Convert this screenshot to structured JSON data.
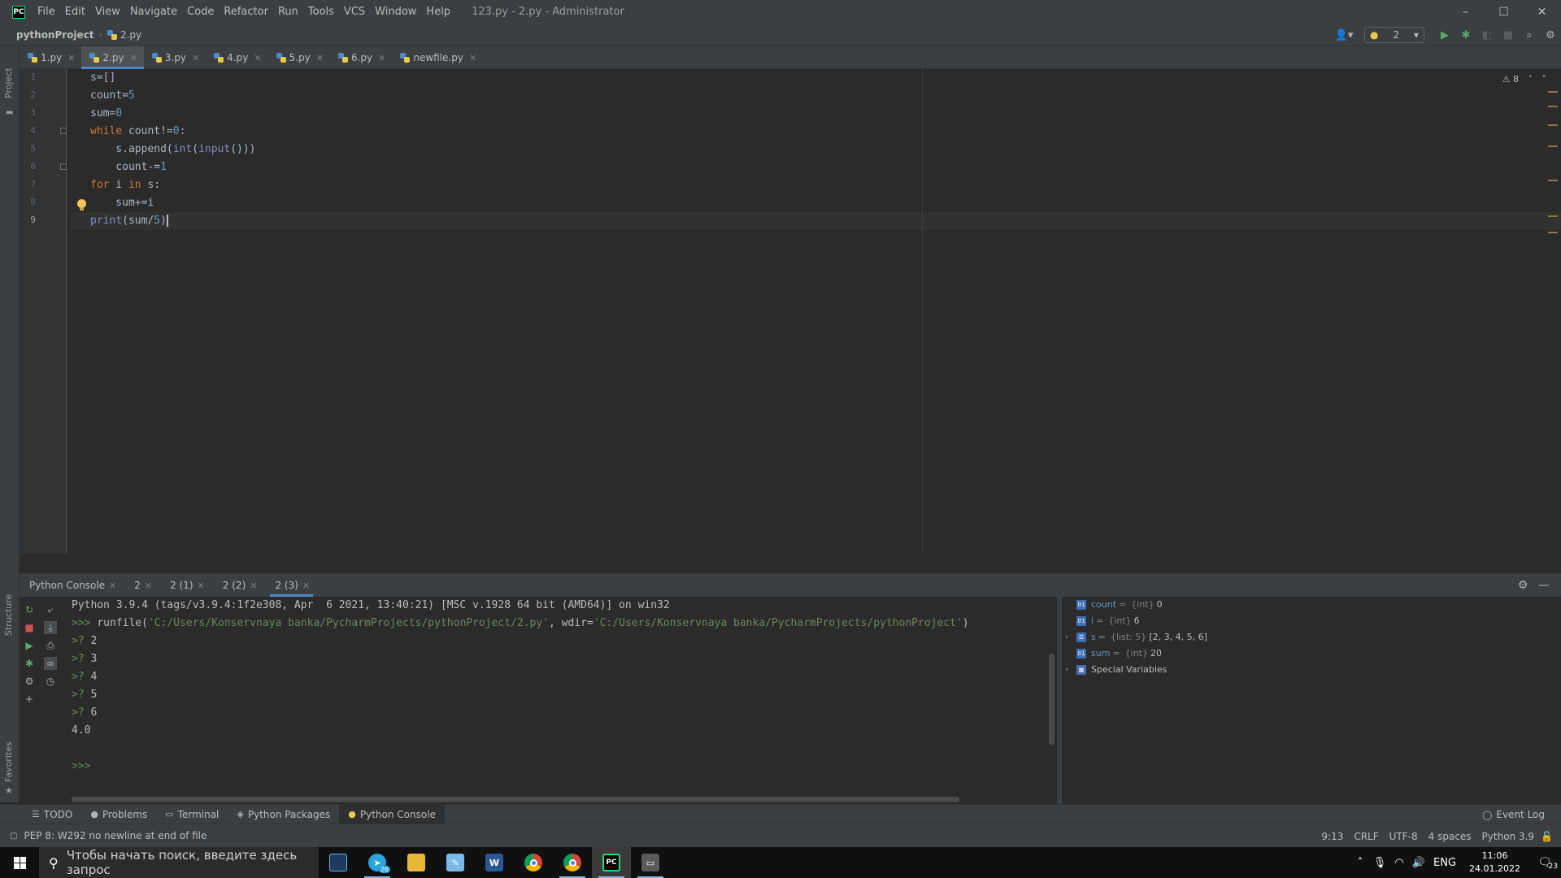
{
  "titlebar": {
    "logo": "PC",
    "menu": [
      "File",
      "Edit",
      "View",
      "Navigate",
      "Code",
      "Refactor",
      "Run",
      "Tools",
      "VCS",
      "Window",
      "Help"
    ],
    "window_title": "123.py - 2.py - Administrator",
    "controls": {
      "minimize": "–",
      "maximize": "☐",
      "close": "✕"
    }
  },
  "navbar": {
    "project": "pythonProject",
    "file": "2.py",
    "run_config": "2"
  },
  "left_stripe": {
    "project": "Project",
    "structure": "Structure",
    "favorites": "Favorites"
  },
  "editor_tabs": [
    {
      "label": "1.py",
      "active": false
    },
    {
      "label": "2.py",
      "active": true
    },
    {
      "label": "3.py",
      "active": false
    },
    {
      "label": "4.py",
      "active": false
    },
    {
      "label": "5.py",
      "active": false
    },
    {
      "label": "6.py",
      "active": false
    },
    {
      "label": "newfile.py",
      "active": false
    }
  ],
  "editor": {
    "line_numbers": [
      "1",
      "2",
      "3",
      "4",
      "5",
      "6",
      "7",
      "8",
      "9"
    ],
    "current_line": "9",
    "inspection_count": "8",
    "code": [
      "s=[]",
      "count=5",
      "sum=0",
      "while count!=0:",
      "    s.append(int(input()))",
      "    count-=1",
      "for i in s:",
      "    sum+=i",
      "print(sum/5)"
    ]
  },
  "console_tabs": [
    {
      "label": "Python Console",
      "active": false
    },
    {
      "label": "2",
      "active": false
    },
    {
      "label": "2 (1)",
      "active": false
    },
    {
      "label": "2 (2)",
      "active": false
    },
    {
      "label": "2 (3)",
      "active": true
    }
  ],
  "console": {
    "banner": "Python 3.9.4 (tags/v3.9.4:1f2e308, Apr  6 2021, 13:40:21) [MSC v.1928 64 bit (AMD64)] on win32",
    "prompt": ">>>",
    "input_prompt": ">?",
    "runfile_cmd": "runfile(",
    "runfile_path": "'C:/Users/Konservnaya banka/PycharmProjects/pythonProject/2.py'",
    "runfile_sep": ", wdir=",
    "runfile_wdir": "'C:/Users/Konservnaya banka/PycharmProjects/pythonProject'",
    "runfile_end": ")",
    "inputs": [
      "2",
      "3",
      "4",
      "5",
      "6"
    ],
    "result": "4.0"
  },
  "variables": [
    {
      "name": "count",
      "type": "{int}",
      "value": "0",
      "expandable": false
    },
    {
      "name": "i",
      "type": "{int}",
      "value": "6",
      "expandable": false
    },
    {
      "name": "s",
      "type": "{list: 5}",
      "value": "[2, 3, 4, 5, 6]",
      "expandable": true
    },
    {
      "name": "sum",
      "type": "{int}",
      "value": "20",
      "expandable": false
    },
    {
      "name": "Special Variables",
      "type": "",
      "value": "",
      "expandable": true
    }
  ],
  "tool_stripe": {
    "todo": "TODO",
    "problems": "Problems",
    "terminal": "Terminal",
    "packages": "Python Packages",
    "console": "Python Console",
    "event_log": "Event Log"
  },
  "statusbar": {
    "message": "PEP 8: W292 no newline at end of file",
    "position": "9:13",
    "line_sep": "CRLF",
    "encoding": "UTF-8",
    "indent": "4 spaces",
    "interpreter": "Python 3.9"
  },
  "taskbar": {
    "search_placeholder": "Чтобы начать поиск, введите здесь запрос",
    "telegram_badge": "26",
    "lang": "ENG",
    "time": "11:06",
    "date": "24.01.2022",
    "notifications": "23"
  }
}
